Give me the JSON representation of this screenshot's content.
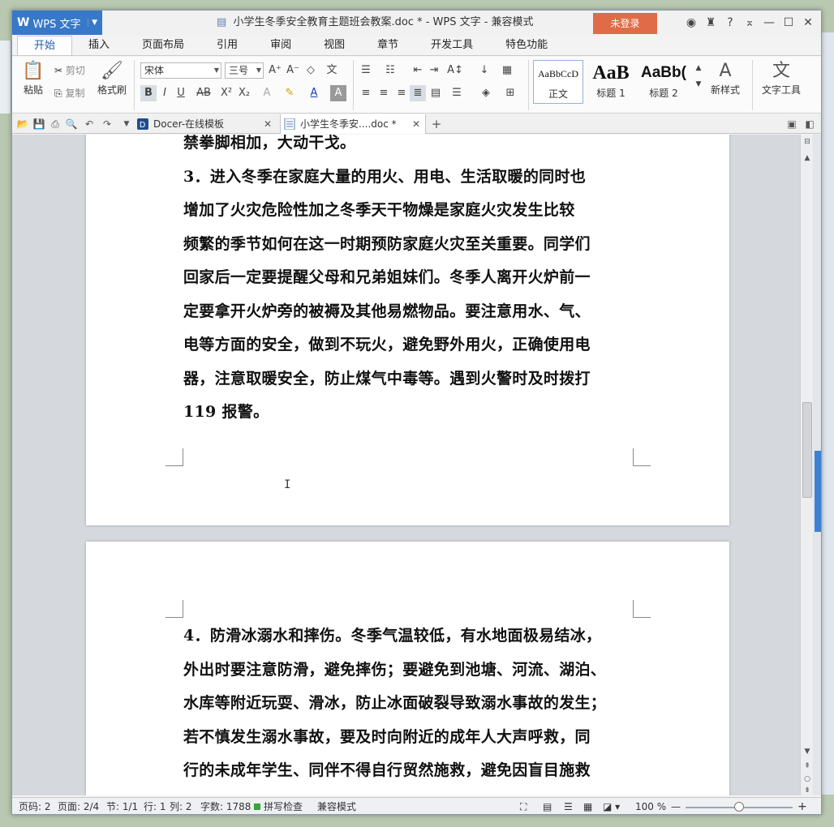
{
  "window": {
    "app_menu_label": "WPS 文字",
    "doc_title": "小学生冬季安全教育主题班会教案.doc * - WPS 文字 - 兼容模式",
    "login_label": "未登录"
  },
  "tabs": [
    "开始",
    "插入",
    "页面布局",
    "引用",
    "审阅",
    "视图",
    "章节",
    "开发工具",
    "特色功能"
  ],
  "ribbon": {
    "paste_label": "粘贴",
    "cut_label": "剪切",
    "copy_label": "复制",
    "format_painter_label": "格式刷",
    "font_name": "宋体",
    "font_size": "三号",
    "styles": [
      {
        "sample": "AaBbCcD",
        "label": "正文"
      },
      {
        "sample": "AaB",
        "label": "标题 1"
      },
      {
        "sample": "AaBb(",
        "label": "标题 2"
      }
    ],
    "new_style_label": "新样式",
    "text_tools_label": "文字工具"
  },
  "doc_tabs": [
    {
      "label": "Docer-在线模板"
    },
    {
      "label": "小学生冬季安....doc *"
    }
  ],
  "page1_lines": [
    "禁拳脚相加，大动干戈。",
    "3．进入冬季在家庭大量的用火、用电、生活取暖的同时也",
    "增加了火灾危险性加之冬季天干物燥是家庭火灾发生比较",
    "频繁的季节如何在这一时期预防家庭火灾至关重要。同学们",
    "回家后一定要提醒父母和兄弟姐妹们。冬季人离开火炉前一",
    "定要拿开火炉旁的被褥及其他易燃物品。要注意用水、气、",
    "电等方面的安全，做到不玩火，避免野外用火，正确使用电",
    "器，注意取暖安全，防止煤气中毒等。遇到火警时及时拨打",
    "119 报警。"
  ],
  "page2_lines": [
    "4．防滑冰溺水和摔伤。冬季气温较低，有水地面极易结冰，",
    "外出时要注意防滑，避免摔伤；要避免到池塘、河流、湖泊、",
    "水库等附近玩耍、滑冰，防止冰面破裂导致溺水事故的发生；",
    "若不慎发生溺水事故，要及时向附近的成年人大声呼救，同",
    "行的未成年学生、同伴不得自行贸然施救，避免因盲目施救"
  ],
  "status": {
    "page_code": "页码: 2",
    "pages": "页面: 2/4",
    "section": "节: 1/1",
    "row": "行: 1",
    "col": "列: 2",
    "word_count": "字数: 1788",
    "spell_check": "拼写检查",
    "compat_mode": "兼容模式",
    "zoom": "100 %"
  },
  "colors": {
    "accent": "#3878c8",
    "login": "#e06b47",
    "active_tab_text": "#1f5fad"
  }
}
